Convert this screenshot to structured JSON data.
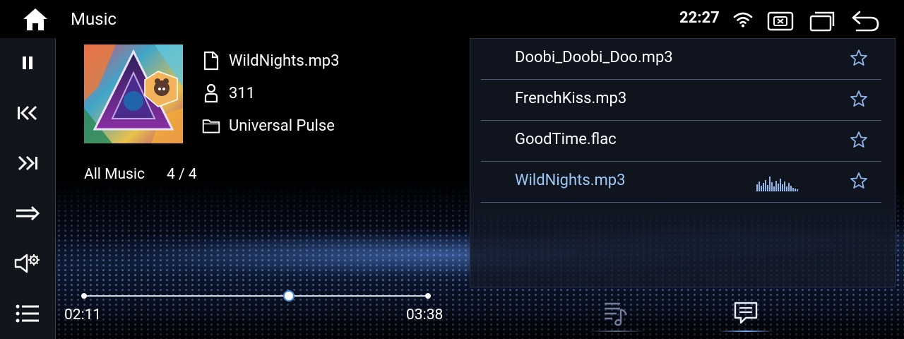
{
  "topbar": {
    "app_title": "Music",
    "clock": "22:27",
    "icons": [
      "home-icon",
      "wifi-icon",
      "close-screen-icon",
      "window-icon",
      "back-icon"
    ]
  },
  "sidebar": {
    "items": [
      {
        "name": "pause-icon"
      },
      {
        "name": "previous-icon"
      },
      {
        "name": "next-icon"
      },
      {
        "name": "repeat-sequence-icon"
      },
      {
        "name": "audio-settings-icon"
      },
      {
        "name": "menu-list-icon"
      }
    ]
  },
  "now_playing": {
    "file": "WildNights.mp3",
    "artist": "311",
    "album": "Universal Pulse",
    "playlist_label": "All Music",
    "playlist_count": "4 / 4",
    "elapsed": "02:11",
    "total": "03:38",
    "progress": 0.6
  },
  "playlist": {
    "tracks": [
      {
        "name": "Doobi_Doobi_Doo.mp3",
        "active": false
      },
      {
        "name": "FrenchKiss.mp3",
        "active": false
      },
      {
        "name": "GoodTime.flac",
        "active": false
      },
      {
        "name": "WildNights.mp3",
        "active": true
      }
    ]
  },
  "tabs": {
    "items": [
      {
        "name": "music-list-icon",
        "active": false
      },
      {
        "name": "lyrics-icon",
        "active": true
      }
    ]
  },
  "colors": {
    "accent": "#9ec9f5",
    "divider": "#4a5872",
    "sidebar_bg": "#13151c"
  }
}
